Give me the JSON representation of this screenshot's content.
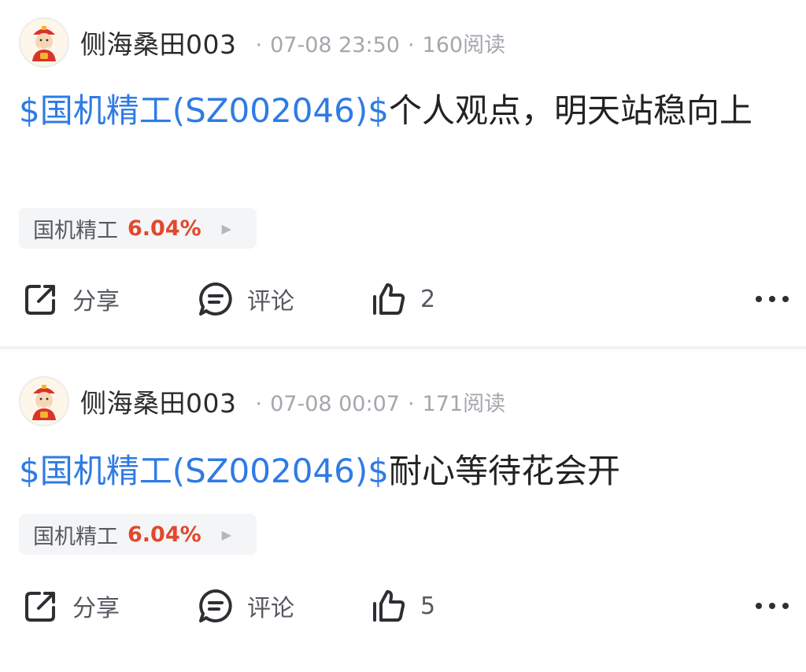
{
  "posts": [
    {
      "username": "侧海桑田003",
      "time": "07-08 23:50",
      "reads": "160阅读",
      "stock_link": "$国机精工(SZ002046)$",
      "text": "个人观点，明天站稳向上",
      "chip": {
        "name": "国机精工",
        "change": "6.04%"
      },
      "actions": {
        "share": "分享",
        "comment": "评论",
        "likes": "2"
      }
    },
    {
      "username": "侧海桑田003",
      "time": "07-08 00:07",
      "reads": "171阅读",
      "stock_link": "$国机精工(SZ002046)$",
      "text": "耐心等待花会开",
      "chip": {
        "name": "国机精工",
        "change": "6.04%"
      },
      "actions": {
        "share": "分享",
        "comment": "评论",
        "likes": "5"
      }
    }
  ],
  "meta_separator": "·",
  "icons": {
    "avatar": "caishen-avatar-icon",
    "share": "share-icon",
    "comment": "comment-icon",
    "like": "thumbs-up-icon",
    "more": "more-dots-icon",
    "chip_arrow": "triangle-right-icon"
  },
  "colors": {
    "link": "#2f7be5",
    "change_up": "#e2482b",
    "meta": "#a4a7ad",
    "chip_bg": "#f4f5f7"
  }
}
